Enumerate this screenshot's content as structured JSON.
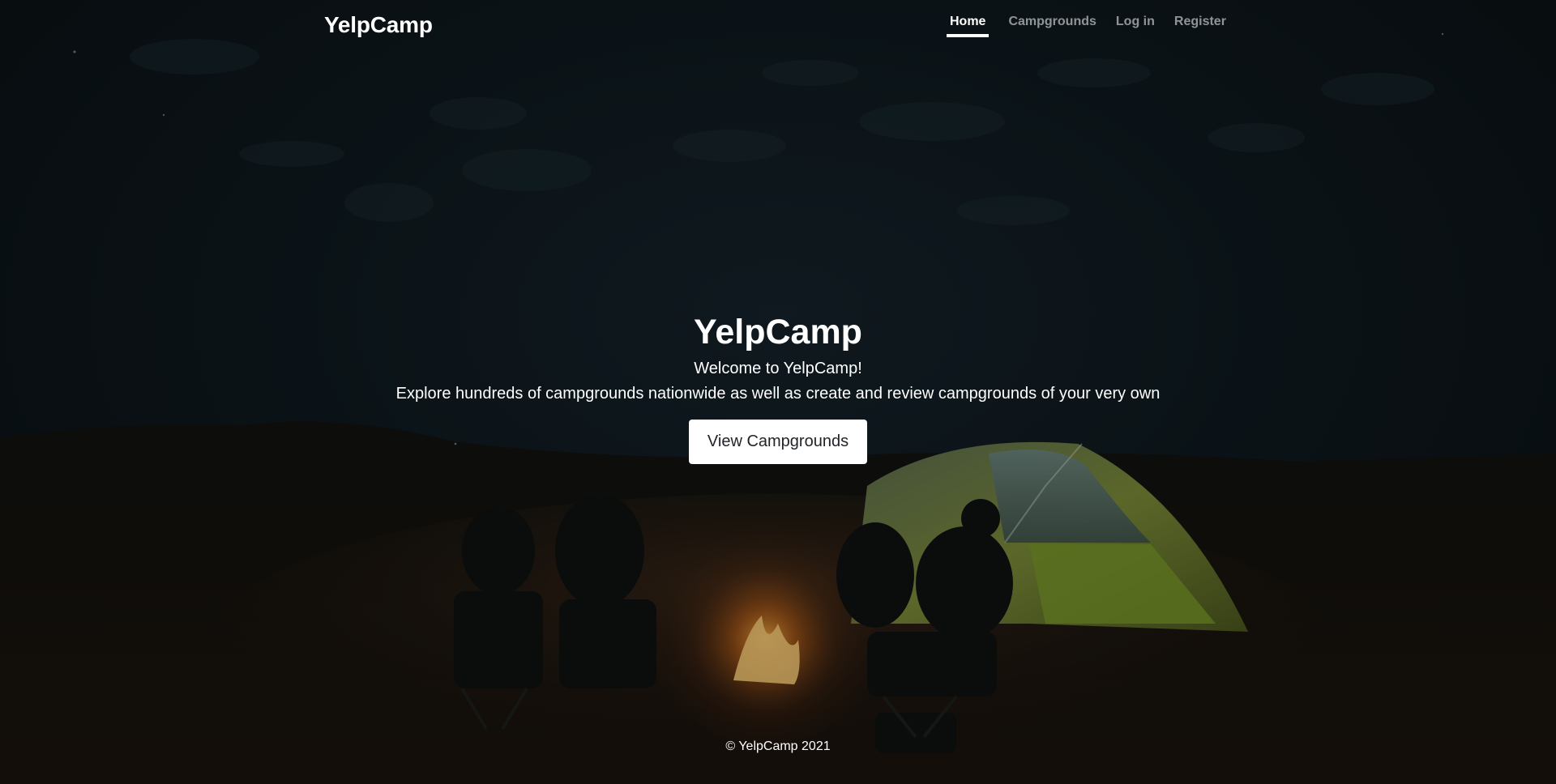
{
  "header": {
    "brand": "YelpCamp",
    "nav": [
      {
        "label": "Home",
        "active": true
      },
      {
        "label": "Campgrounds",
        "active": false
      },
      {
        "label": "Log in",
        "active": false
      },
      {
        "label": "Register",
        "active": false
      }
    ]
  },
  "hero": {
    "title": "YelpCamp",
    "welcome": "Welcome to YelpCamp!",
    "tagline": "Explore hundreds of campgrounds nationwide as well as create and review campgrounds of your very own",
    "button_label": "View Campgrounds"
  },
  "footer": {
    "text": "© YelpCamp 2021"
  },
  "background": {
    "description_icon": "campfire-tent-night-photo"
  },
  "colors": {
    "text": "#ffffff",
    "button_bg": "#ffffff",
    "button_text": "#212529",
    "nav_inactive": "rgba(255,255,255,0.55)"
  }
}
